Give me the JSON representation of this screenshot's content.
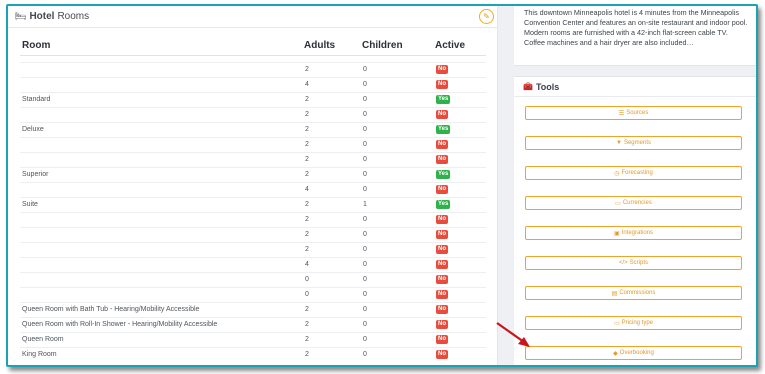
{
  "rooms_panel": {
    "title_bold": "Hotel",
    "title_rest": "Rooms",
    "columns": {
      "room": "Room",
      "adults": "Adults",
      "children": "Children",
      "active": "Active"
    },
    "rows": [
      {
        "room": "",
        "adults": "2",
        "children": "0",
        "active": "No"
      },
      {
        "room": "",
        "adults": "4",
        "children": "0",
        "active": "No"
      },
      {
        "room": "Standard",
        "adults": "2",
        "children": "0",
        "active": "Yes"
      },
      {
        "room": "",
        "adults": "2",
        "children": "0",
        "active": "No"
      },
      {
        "room": "Deluxe",
        "adults": "2",
        "children": "0",
        "active": "Yes"
      },
      {
        "room": "",
        "adults": "2",
        "children": "0",
        "active": "No"
      },
      {
        "room": "",
        "adults": "2",
        "children": "0",
        "active": "No"
      },
      {
        "room": "Superior",
        "adults": "2",
        "children": "0",
        "active": "Yes"
      },
      {
        "room": "",
        "adults": "4",
        "children": "0",
        "active": "No"
      },
      {
        "room": "Suite",
        "adults": "2",
        "children": "1",
        "active": "Yes"
      },
      {
        "room": "",
        "adults": "2",
        "children": "0",
        "active": "No"
      },
      {
        "room": "",
        "adults": "2",
        "children": "0",
        "active": "No"
      },
      {
        "room": "",
        "adults": "2",
        "children": "0",
        "active": "No"
      },
      {
        "room": "",
        "adults": "4",
        "children": "0",
        "active": "No"
      },
      {
        "room": "",
        "adults": "0",
        "children": "0",
        "active": "No"
      },
      {
        "room": "",
        "adults": "0",
        "children": "0",
        "active": "No"
      },
      {
        "room": "Queen Room with Bath Tub - Hearing/Mobility Accessible",
        "adults": "2",
        "children": "0",
        "active": "No"
      },
      {
        "room": "Queen Room with Roll-In Shower - Hearing/Mobility Accessible",
        "adults": "2",
        "children": "0",
        "active": "No"
      },
      {
        "room": "Queen Room",
        "adults": "2",
        "children": "0",
        "active": "No"
      },
      {
        "room": "King Room",
        "adults": "2",
        "children": "0",
        "active": "No"
      }
    ]
  },
  "description": "This downtown Minneapolis hotel is 4 minutes from the Minneapolis Convention Center and features an on-site restaurant and indoor pool. Modern rooms are furnished with a 42-inch flat-screen cable TV. Coffee machines and a hair dryer are also included…",
  "tools": {
    "title": "Tools",
    "buttons": [
      {
        "label": "Sources",
        "icon": "sliders-icon"
      },
      {
        "label": "Segments",
        "icon": "filter-icon"
      },
      {
        "label": "Forecasting",
        "icon": "clock-icon"
      },
      {
        "label": "Currencies",
        "icon": "money-icon"
      },
      {
        "label": "Integrations",
        "icon": "briefcase-icon"
      },
      {
        "label": "Scripts",
        "icon": "code-icon"
      },
      {
        "label": "Commissions",
        "icon": "receipt-icon"
      },
      {
        "label": "Pricing type",
        "icon": "card-icon"
      },
      {
        "label": "Overbooking",
        "icon": "bell-icon"
      }
    ]
  },
  "colors": {
    "accent": "#f0a32b",
    "badge_no": "#e74c3c",
    "badge_yes": "#2db34a",
    "frame": "#1aa3b5",
    "arrow": "#c8161d"
  }
}
